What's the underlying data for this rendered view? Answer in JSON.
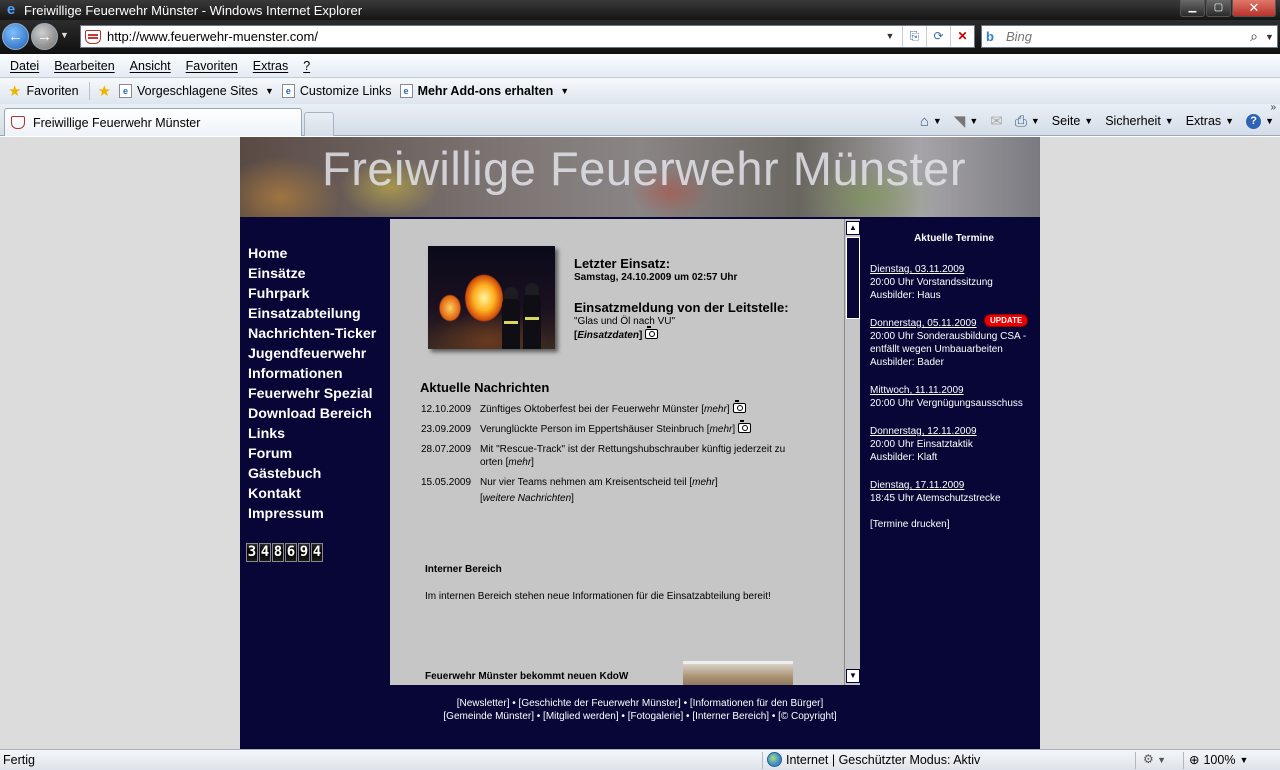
{
  "window": {
    "title": "Freiwillige Feuerwehr Münster - Windows Internet Explorer",
    "controls": [
      "minimize",
      "maximize",
      "close"
    ]
  },
  "address": {
    "url": "http://www.feuerwehr-muenster.com/",
    "search_placeholder": "Bing"
  },
  "menu": [
    "Datei",
    "Bearbeiten",
    "Ansicht",
    "Favoriten",
    "Extras",
    "?"
  ],
  "favorites_bar": {
    "favorites": "Favoriten",
    "suggested": "Vorgeschlagene Sites",
    "customize": "Customize Links",
    "addons": "Mehr Add-ons erhalten"
  },
  "tab": {
    "title": "Freiwillige Feuerwehr Münster"
  },
  "command_bar": {
    "page": "Seite",
    "security": "Sicherheit",
    "tools": "Extras"
  },
  "site": {
    "banner_title": "Freiwillige Feuerwehr Münster",
    "nav": [
      "Home",
      "Einsätze",
      "Fuhrpark",
      "Einsatzabteilung",
      "Nachrichten-Ticker",
      "Jugendfeuerwehr",
      "Informationen",
      "Feuerwehr Spezial",
      "Download Bereich",
      "Links",
      "Forum",
      "Gästebuch",
      "Kontakt",
      "Impressum"
    ],
    "counter": [
      "3",
      "4",
      "8",
      "6",
      "9",
      "4"
    ],
    "last_mission": {
      "heading": "Letzter Einsatz:",
      "date": "Samstag, 24.10.2009 um 02:57 Uhr",
      "report_heading": "Einsatzmeldung von der Leitstelle:",
      "report_text": "\"Glas und Öl nach VU\"",
      "data_link": "Einsatzdaten"
    },
    "news": {
      "heading": "Aktuelle Nachrichten",
      "items": [
        {
          "date": "12.10.2009",
          "text": "Zünftiges Oktoberfest bei der Feuerwehr Münster",
          "more": "mehr"
        },
        {
          "date": "23.09.2009",
          "text": "Verunglückte Person im Eppertshäuser Steinbruch",
          "more": "mehr"
        },
        {
          "date": "28.07.2009",
          "text": "Mit \"Rescue-Track\" ist der Rettungshubschrauber künftig jederzeit zu orten",
          "more": "mehr"
        },
        {
          "date": "15.05.2009",
          "text": "Nur vier Teams nehmen am Kreisentscheid teil",
          "more": "mehr"
        }
      ],
      "more_news": "weitere Nachrichten"
    },
    "internal": {
      "heading": "Interner Bereich",
      "text": "Im internen Bereich stehen neue Informationen für die Einsatzabteilung bereit!"
    },
    "kdow_heading": "Feuerwehr Münster bekommt neuen KdoW",
    "termine": {
      "heading": "Aktuelle Termine",
      "update_badge": "UPDATE",
      "entries": [
        {
          "date": "Dienstag, 03.11.2009",
          "line1": "20:00 Uhr Vorstandssitzung",
          "line2": "Ausbilder: Haus"
        },
        {
          "date": "Donnerstag, 05.11.2009",
          "line1": "20:00 Uhr Sonderausbildung CSA - entfällt wegen Umbauarbeiten",
          "line2": "Ausbilder: Bader"
        },
        {
          "date": "Mittwoch, 11.11.2009",
          "line1": "20:00 Uhr Vergnügungsausschuss",
          "line2": ""
        },
        {
          "date": "Donnerstag, 12.11.2009",
          "line1": "20:00 Uhr Einsatztaktik",
          "line2": "Ausbilder: Klaft"
        },
        {
          "date": "Dienstag, 17.11.2009",
          "line1": "18:45 Uhr Atemschutzstrecke",
          "line2": ""
        }
      ],
      "print": "[Termine drucken]"
    },
    "footer": {
      "line1": "[Newsletter] • [Geschichte der Feuerwehr Münster] • [Informationen für den Bürger]",
      "line2": "[Gemeinde Münster] • [Mitglied werden] • [Fotogalerie] • [Interner Bereich] • [© Copyright]"
    }
  },
  "status": {
    "text": "Fertig",
    "zone": "Internet | Geschützter Modus: Aktiv",
    "zoom": "100%"
  }
}
